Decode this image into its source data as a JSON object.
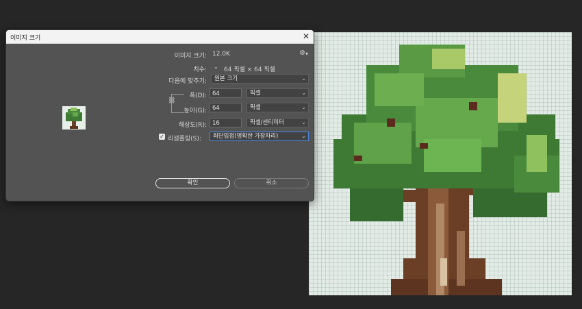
{
  "dialog": {
    "title": "이미지 크기",
    "close_glyph": "✕",
    "image_size_label": "이미지 크기:",
    "image_size_value": "12.0K",
    "dimensions_label": "치수:",
    "dimensions_value": "64 픽셀  ×  64 픽셀",
    "fit_to_label": "다음에 맞추기:",
    "fit_to_value": "원본 크기",
    "width_label": "폭(D):",
    "width_value": "64",
    "width_unit": "픽셀",
    "height_label": "높이(G):",
    "height_value": "64",
    "height_unit": "픽셀",
    "resolution_label": "해상도(R):",
    "resolution_value": "16",
    "resolution_unit": "픽셀/센티미터",
    "resample_label": "리샘플링(S):",
    "resample_checked": true,
    "resample_value": "최단입점(명확한 가장자리)",
    "ok_label": "확인",
    "cancel_label": "취소"
  },
  "icons": {
    "close": "close-icon",
    "gear": "gear-icon",
    "chain": "link-chain-icon",
    "chevron": "chevron-down-icon"
  },
  "colors": {
    "app_bg": "#262626",
    "dialog_bg": "#535353",
    "focus_border": "#4a8be0",
    "canvas_bg": "#e3ebe6"
  }
}
